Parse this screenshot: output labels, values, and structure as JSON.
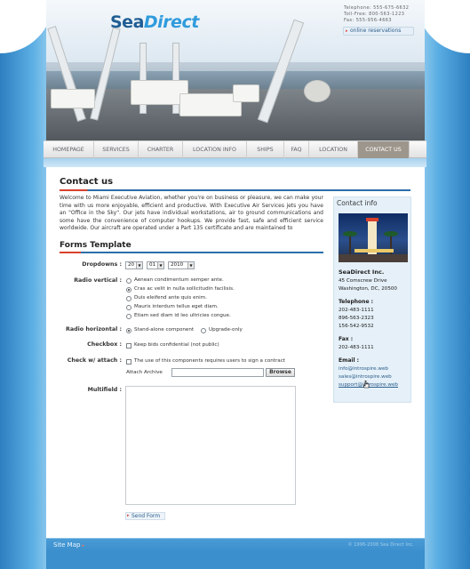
{
  "brand": {
    "logo_text_1": "Sea",
    "logo_text_2": "Direct",
    "telephone_line": "Telephone: 555-675-6632",
    "tollfree_line": "Toll-Free: 800-563-1223",
    "fax_line": "Fax: 555-956-4663",
    "online_reservations": "online reservations"
  },
  "nav": {
    "items": [
      {
        "label": "HOMEPAGE"
      },
      {
        "label": "SERVICES"
      },
      {
        "label": "CHARTER"
      },
      {
        "label": "LOCATION INFO"
      },
      {
        "label": "SHIPS"
      },
      {
        "label": "FAQ"
      },
      {
        "label": "LOCATION"
      },
      {
        "label": "CONTACT US",
        "active": true
      }
    ]
  },
  "main": {
    "title": "Contact us",
    "intro": "Welcome to Miami Executive Aviation, whether you're on business or pleasure, we can make your time with us more enjoyable, efficient and productive. With Executive Air Services jets you have an \"Office in the Sky\". Our jets have individual workstations, air to ground communications and some have the convenience of computer hookups. We provide fast, safe and efficient service worldwide. Our aircraft are operated under a Part 135 certificate and are maintained to",
    "forms_title": "Forms Template"
  },
  "form": {
    "dropdowns_label": "Dropdowns :",
    "dropdown_day": "20",
    "dropdown_month": "01",
    "dropdown_year": "2010",
    "radio_vertical_label": "Radio vertical :",
    "radio_vertical_options": [
      "Aenean condimentum semper ante.",
      "Cras ac velit in nulla sollicitudin facilisis.",
      "Duis eleifend ante quis enim.",
      "Mauris interdum tellus eget diam.",
      "Etiam sed diam id leo ultricies congue."
    ],
    "radio_horizontal_label": "Radio horizontal :",
    "radio_horizontal_options": [
      "Stand-alone component",
      "Upgrade-only"
    ],
    "checkbox_label": "Checkbox :",
    "checkbox_text": "Keep bids confidential (not public)",
    "check_attach_label": "Check w/ attach :",
    "check_attach_text": "The use of this components requires users to sign a contract",
    "attach_archive_label": "Attach Archive",
    "browse_label": "Browse",
    "multifield_label": "Multifield :",
    "send_label": "Send Form"
  },
  "sidebar": {
    "title": "Contact info",
    "company": "SeaDirect Inc.",
    "address_1": "45 Comscrew Drive",
    "address_2": "Washington, DC, 20500",
    "telephone_label": "Telephone :",
    "phones": [
      "202-483-1111",
      "896-563-2323",
      "156-542-9532"
    ],
    "fax_label": "Fax :",
    "fax": "202-483-1111",
    "email_label": "Email :",
    "emails": [
      "info@introspire.web",
      "sales@introspire.web",
      "support@introspire.web"
    ]
  },
  "footer": {
    "site_map": "Site Map",
    "copyright": "© 1996-2008 Sea Direct Inc."
  },
  "colors": {
    "accent_blue": "#2b6ea8",
    "accent_red": "#d9412c",
    "background_blue": "#3a8fcc"
  }
}
